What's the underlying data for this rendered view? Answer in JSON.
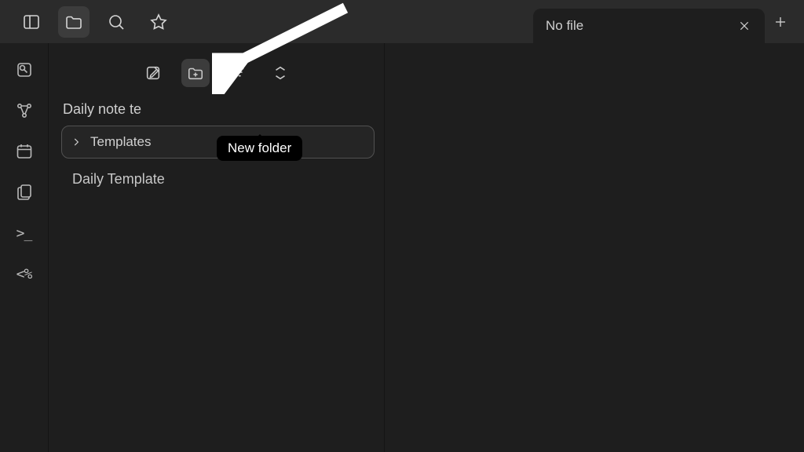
{
  "topbar": {
    "icons": [
      {
        "name": "sidebar-toggle-icon"
      },
      {
        "name": "folder-icon",
        "active": true
      },
      {
        "name": "search-icon"
      },
      {
        "name": "star-icon"
      }
    ]
  },
  "tab": {
    "label": "No file"
  },
  "ribbon": [
    {
      "name": "quick-switcher-icon"
    },
    {
      "name": "graph-view-icon"
    },
    {
      "name": "daily-note-icon"
    },
    {
      "name": "files-icon"
    },
    {
      "name": "command-prompt-icon",
      "text": ">_"
    },
    {
      "name": "template-icon",
      "text": "<%"
    }
  ],
  "sidebar": {
    "toolbar": [
      {
        "name": "new-note-icon"
      },
      {
        "name": "new-folder-icon",
        "hover": true
      },
      {
        "name": "sort-icon"
      },
      {
        "name": "collapse-icon"
      }
    ],
    "vault_name": "Daily note te",
    "folder": {
      "label": "Templates"
    },
    "file": {
      "label": "Daily Template"
    },
    "tooltip": "New folder"
  }
}
